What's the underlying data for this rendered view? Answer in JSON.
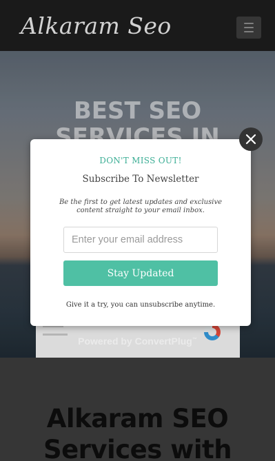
{
  "header": {
    "logo_text": "Alkaram Seo",
    "menu_icon": "hamburger-icon"
  },
  "hero": {
    "title_line1": "BEST SEO",
    "title_line2": "SERVICES IN",
    "powered_by": "Powered by ConvertPlug",
    "powered_by_tm": "™"
  },
  "lower": {
    "title_line1": "Alkaram SEO",
    "title_line2": "Services with"
  },
  "modal": {
    "heading": "DON'T MISS OUT!",
    "title": "Subscribe To Newsletter",
    "description": "Be the first to get latest updates and exclusive content straight to your email inbox.",
    "email_placeholder": "Enter your email address",
    "submit_label": "Stay Updated",
    "note": "Give it a try, you can unsubscribe anytime.",
    "close_icon": "close-icon",
    "accent_color": "#3cae95",
    "button_color": "#4fc0a4"
  }
}
